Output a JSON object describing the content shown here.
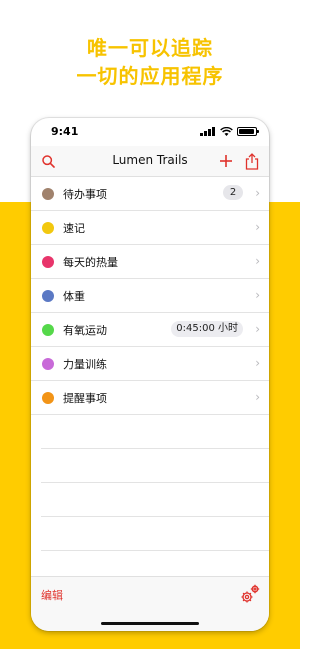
{
  "promo": {
    "line1": "唯一可以追踪",
    "line2": "一切的应用程序"
  },
  "status_bar": {
    "time": "9:41"
  },
  "navbar": {
    "title": "Lumen Trails",
    "search_icon": "search-icon",
    "add_icon": "plus-icon",
    "share_icon": "share-icon"
  },
  "colors": {
    "accent": "#e0322c",
    "promo": "#f7c300",
    "band": "#ffcc00"
  },
  "items": [
    {
      "label": "待办事项",
      "color": "#a0826d",
      "badge": "2"
    },
    {
      "label": "速记",
      "color": "#f2c80f"
    },
    {
      "label": "每天的热量",
      "color": "#e8356b"
    },
    {
      "label": "体重",
      "color": "#5b79c4"
    },
    {
      "label": "有氧运动",
      "color": "#55d84a",
      "value": "0:45:00 小时"
    },
    {
      "label": "力量训练",
      "color": "#c86ad8"
    },
    {
      "label": "提醒事项",
      "color": "#f29417"
    }
  ],
  "toolbar": {
    "edit_label": "编辑",
    "settings_icon": "gears-icon"
  }
}
